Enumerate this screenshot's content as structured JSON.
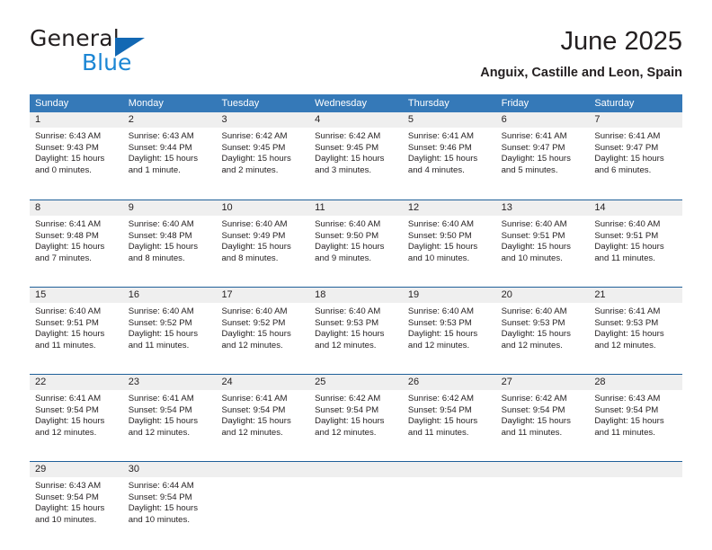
{
  "brand": {
    "name_top": "General",
    "name_bottom": "Blue",
    "triangle_color": "#1268b3",
    "blue_text_color": "#1b86d4"
  },
  "header": {
    "title": "June 2025",
    "subtitle": "Anguix, Castille and Leon, Spain"
  },
  "colors": {
    "header_blue": "#3579b8",
    "row_divider_blue": "#1f6099",
    "day_band_gray": "#efefef",
    "text": "#231f20"
  },
  "weekdays": [
    "Sunday",
    "Monday",
    "Tuesday",
    "Wednesday",
    "Thursday",
    "Friday",
    "Saturday"
  ],
  "weeks": [
    [
      {
        "day": "1",
        "sunrise": "Sunrise: 6:43 AM",
        "sunset": "Sunset: 9:43 PM",
        "daylight_line1": "Daylight: 15 hours",
        "daylight_line2": "and 0 minutes."
      },
      {
        "day": "2",
        "sunrise": "Sunrise: 6:43 AM",
        "sunset": "Sunset: 9:44 PM",
        "daylight_line1": "Daylight: 15 hours",
        "daylight_line2": "and 1 minute."
      },
      {
        "day": "3",
        "sunrise": "Sunrise: 6:42 AM",
        "sunset": "Sunset: 9:45 PM",
        "daylight_line1": "Daylight: 15 hours",
        "daylight_line2": "and 2 minutes."
      },
      {
        "day": "4",
        "sunrise": "Sunrise: 6:42 AM",
        "sunset": "Sunset: 9:45 PM",
        "daylight_line1": "Daylight: 15 hours",
        "daylight_line2": "and 3 minutes."
      },
      {
        "day": "5",
        "sunrise": "Sunrise: 6:41 AM",
        "sunset": "Sunset: 9:46 PM",
        "daylight_line1": "Daylight: 15 hours",
        "daylight_line2": "and 4 minutes."
      },
      {
        "day": "6",
        "sunrise": "Sunrise: 6:41 AM",
        "sunset": "Sunset: 9:47 PM",
        "daylight_line1": "Daylight: 15 hours",
        "daylight_line2": "and 5 minutes."
      },
      {
        "day": "7",
        "sunrise": "Sunrise: 6:41 AM",
        "sunset": "Sunset: 9:47 PM",
        "daylight_line1": "Daylight: 15 hours",
        "daylight_line2": "and 6 minutes."
      }
    ],
    [
      {
        "day": "8",
        "sunrise": "Sunrise: 6:41 AM",
        "sunset": "Sunset: 9:48 PM",
        "daylight_line1": "Daylight: 15 hours",
        "daylight_line2": "and 7 minutes."
      },
      {
        "day": "9",
        "sunrise": "Sunrise: 6:40 AM",
        "sunset": "Sunset: 9:48 PM",
        "daylight_line1": "Daylight: 15 hours",
        "daylight_line2": "and 8 minutes."
      },
      {
        "day": "10",
        "sunrise": "Sunrise: 6:40 AM",
        "sunset": "Sunset: 9:49 PM",
        "daylight_line1": "Daylight: 15 hours",
        "daylight_line2": "and 8 minutes."
      },
      {
        "day": "11",
        "sunrise": "Sunrise: 6:40 AM",
        "sunset": "Sunset: 9:50 PM",
        "daylight_line1": "Daylight: 15 hours",
        "daylight_line2": "and 9 minutes."
      },
      {
        "day": "12",
        "sunrise": "Sunrise: 6:40 AM",
        "sunset": "Sunset: 9:50 PM",
        "daylight_line1": "Daylight: 15 hours",
        "daylight_line2": "and 10 minutes."
      },
      {
        "day": "13",
        "sunrise": "Sunrise: 6:40 AM",
        "sunset": "Sunset: 9:51 PM",
        "daylight_line1": "Daylight: 15 hours",
        "daylight_line2": "and 10 minutes."
      },
      {
        "day": "14",
        "sunrise": "Sunrise: 6:40 AM",
        "sunset": "Sunset: 9:51 PM",
        "daylight_line1": "Daylight: 15 hours",
        "daylight_line2": "and 11 minutes."
      }
    ],
    [
      {
        "day": "15",
        "sunrise": "Sunrise: 6:40 AM",
        "sunset": "Sunset: 9:51 PM",
        "daylight_line1": "Daylight: 15 hours",
        "daylight_line2": "and 11 minutes."
      },
      {
        "day": "16",
        "sunrise": "Sunrise: 6:40 AM",
        "sunset": "Sunset: 9:52 PM",
        "daylight_line1": "Daylight: 15 hours",
        "daylight_line2": "and 11 minutes."
      },
      {
        "day": "17",
        "sunrise": "Sunrise: 6:40 AM",
        "sunset": "Sunset: 9:52 PM",
        "daylight_line1": "Daylight: 15 hours",
        "daylight_line2": "and 12 minutes."
      },
      {
        "day": "18",
        "sunrise": "Sunrise: 6:40 AM",
        "sunset": "Sunset: 9:53 PM",
        "daylight_line1": "Daylight: 15 hours",
        "daylight_line2": "and 12 minutes."
      },
      {
        "day": "19",
        "sunrise": "Sunrise: 6:40 AM",
        "sunset": "Sunset: 9:53 PM",
        "daylight_line1": "Daylight: 15 hours",
        "daylight_line2": "and 12 minutes."
      },
      {
        "day": "20",
        "sunrise": "Sunrise: 6:40 AM",
        "sunset": "Sunset: 9:53 PM",
        "daylight_line1": "Daylight: 15 hours",
        "daylight_line2": "and 12 minutes."
      },
      {
        "day": "21",
        "sunrise": "Sunrise: 6:41 AM",
        "sunset": "Sunset: 9:53 PM",
        "daylight_line1": "Daylight: 15 hours",
        "daylight_line2": "and 12 minutes."
      }
    ],
    [
      {
        "day": "22",
        "sunrise": "Sunrise: 6:41 AM",
        "sunset": "Sunset: 9:54 PM",
        "daylight_line1": "Daylight: 15 hours",
        "daylight_line2": "and 12 minutes."
      },
      {
        "day": "23",
        "sunrise": "Sunrise: 6:41 AM",
        "sunset": "Sunset: 9:54 PM",
        "daylight_line1": "Daylight: 15 hours",
        "daylight_line2": "and 12 minutes."
      },
      {
        "day": "24",
        "sunrise": "Sunrise: 6:41 AM",
        "sunset": "Sunset: 9:54 PM",
        "daylight_line1": "Daylight: 15 hours",
        "daylight_line2": "and 12 minutes."
      },
      {
        "day": "25",
        "sunrise": "Sunrise: 6:42 AM",
        "sunset": "Sunset: 9:54 PM",
        "daylight_line1": "Daylight: 15 hours",
        "daylight_line2": "and 12 minutes."
      },
      {
        "day": "26",
        "sunrise": "Sunrise: 6:42 AM",
        "sunset": "Sunset: 9:54 PM",
        "daylight_line1": "Daylight: 15 hours",
        "daylight_line2": "and 11 minutes."
      },
      {
        "day": "27",
        "sunrise": "Sunrise: 6:42 AM",
        "sunset": "Sunset: 9:54 PM",
        "daylight_line1": "Daylight: 15 hours",
        "daylight_line2": "and 11 minutes."
      },
      {
        "day": "28",
        "sunrise": "Sunrise: 6:43 AM",
        "sunset": "Sunset: 9:54 PM",
        "daylight_line1": "Daylight: 15 hours",
        "daylight_line2": "and 11 minutes."
      }
    ],
    [
      {
        "day": "29",
        "sunrise": "Sunrise: 6:43 AM",
        "sunset": "Sunset: 9:54 PM",
        "daylight_line1": "Daylight: 15 hours",
        "daylight_line2": "and 10 minutes."
      },
      {
        "day": "30",
        "sunrise": "Sunrise: 6:44 AM",
        "sunset": "Sunset: 9:54 PM",
        "daylight_line1": "Daylight: 15 hours",
        "daylight_line2": "and 10 minutes."
      },
      {
        "day": "",
        "sunrise": "",
        "sunset": "",
        "daylight_line1": "",
        "daylight_line2": ""
      },
      {
        "day": "",
        "sunrise": "",
        "sunset": "",
        "daylight_line1": "",
        "daylight_line2": ""
      },
      {
        "day": "",
        "sunrise": "",
        "sunset": "",
        "daylight_line1": "",
        "daylight_line2": ""
      },
      {
        "day": "",
        "sunrise": "",
        "sunset": "",
        "daylight_line1": "",
        "daylight_line2": ""
      },
      {
        "day": "",
        "sunrise": "",
        "sunset": "",
        "daylight_line1": "",
        "daylight_line2": ""
      }
    ]
  ]
}
